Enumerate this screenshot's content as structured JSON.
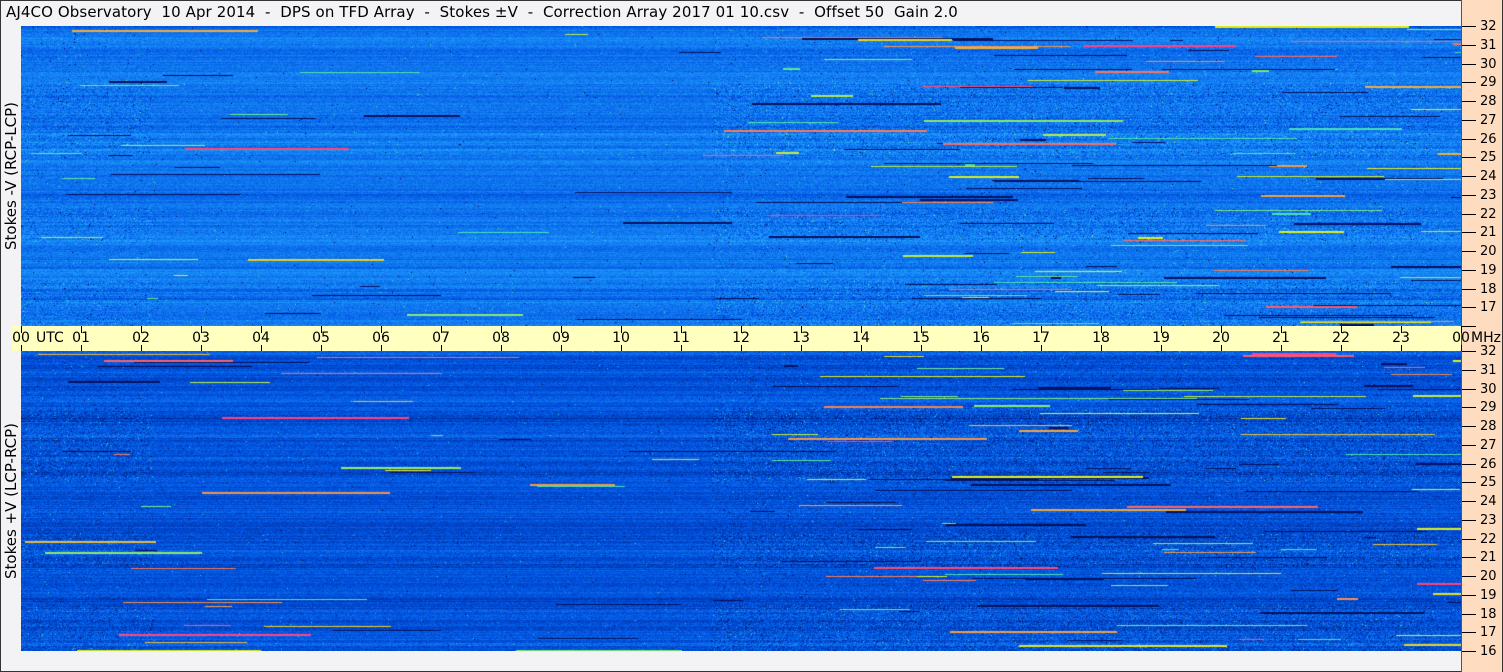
{
  "title": "AJ4CO Observatory  10 Apr 2014  -  DPS on TFD Array  -  Stokes ±V  -  Correction Array 2017 01 10.csv  -  Offset 50  Gain 2.0",
  "panels": [
    {
      "label": "Stokes -V (RCP-LCP)"
    },
    {
      "label": "Stokes +V (LCP-RCP)"
    }
  ],
  "time_axis": {
    "unit": "UTC",
    "ticks": [
      "00",
      "01",
      "02",
      "03",
      "04",
      "05",
      "06",
      "07",
      "08",
      "09",
      "10",
      "11",
      "12",
      "13",
      "14",
      "15",
      "16",
      "17",
      "18",
      "19",
      "20",
      "21",
      "22",
      "23",
      "00"
    ]
  },
  "freq_axis": {
    "unit": "MHz",
    "ticks": [
      "32",
      "31",
      "30",
      "29",
      "28",
      "27",
      "26",
      "25",
      "24",
      "23",
      "22",
      "21",
      "20",
      "19",
      "18",
      "17",
      "16"
    ]
  },
  "colors": {
    "background": "#f3f3f6",
    "time_bar": "#ffffc0",
    "freq_bar": "#fddcc0",
    "low": "#000a50",
    "mid": "#0050e0",
    "high": "#ffffff"
  },
  "chart_data": {
    "type": "heatmap",
    "title": "AJ4CO Observatory  10 Apr 2014  -  DPS on TFD Array  -  Stokes ±V  -  Correction Array 2017 01 10.csv  -  Offset 50  Gain 2.0",
    "xlabel": "UTC",
    "ylabel": "MHz",
    "xlim": [
      "00",
      "00"
    ],
    "ylim": [
      16,
      32
    ],
    "panels": [
      "Stokes -V (RCP-LCP)",
      "Stokes +V (LCP-RCP)"
    ],
    "colormap": [
      "#000a50",
      "#0050e0",
      "#20a0ff",
      "#40e0c0",
      "#e0f020",
      "#ff4080",
      "#ffffff"
    ]
  }
}
